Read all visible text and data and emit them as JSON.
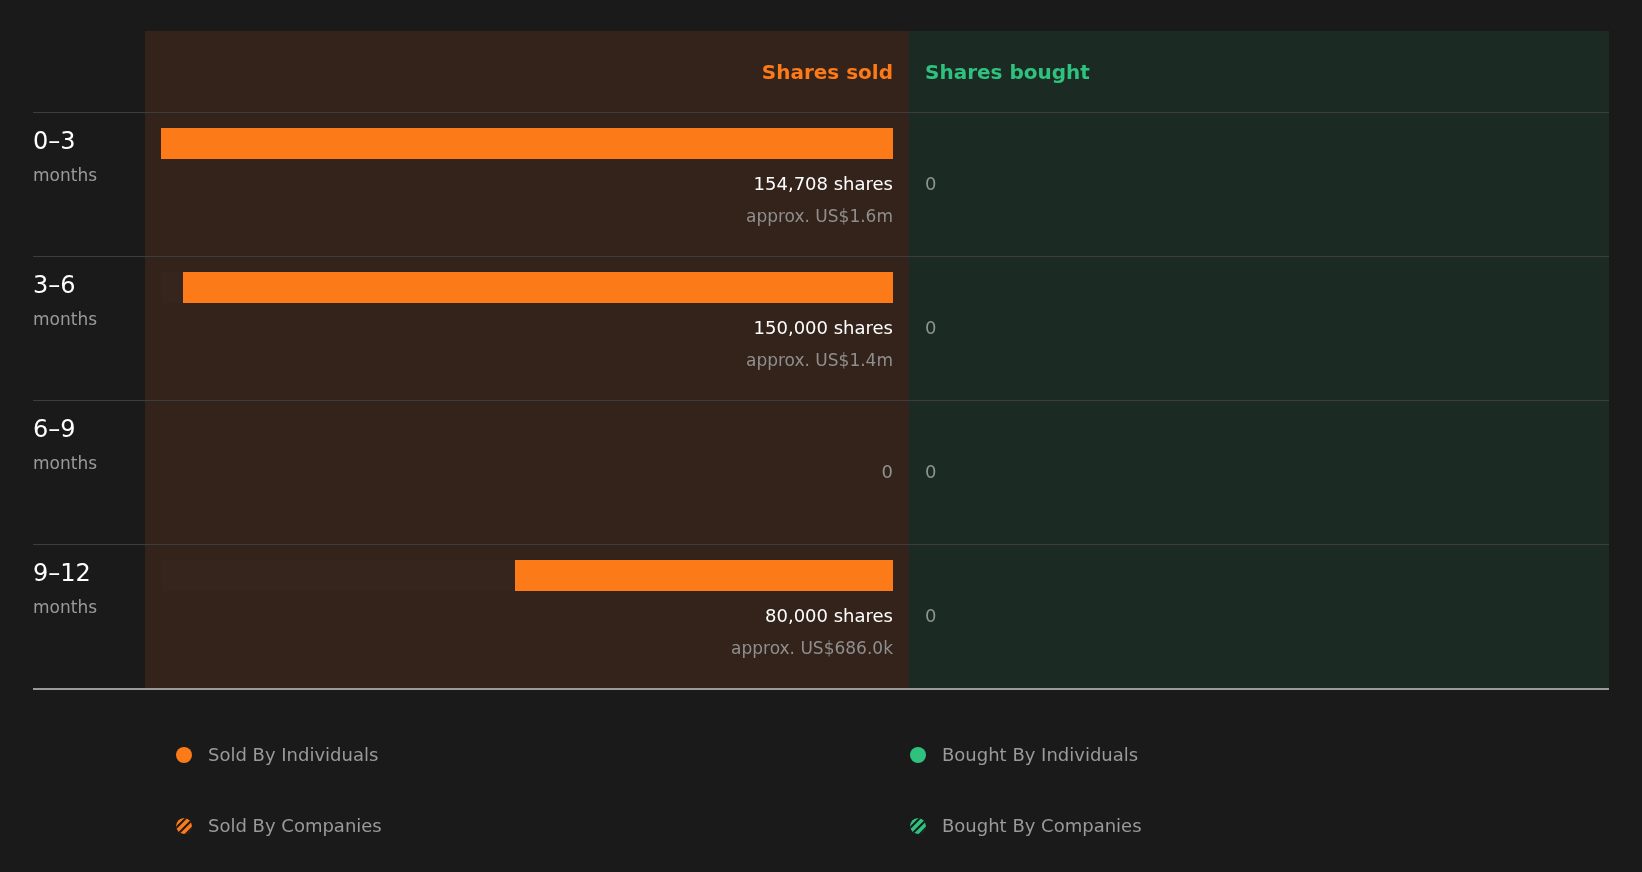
{
  "columns": {
    "sold": "Shares sold",
    "bought": "Shares bought"
  },
  "rows": [
    {
      "period": "0–3",
      "unit": "months",
      "sold": {
        "level": 1,
        "shares": "154,708 shares",
        "value": "approx. US$1.6m"
      },
      "bought": {
        "shares": "0"
      }
    },
    {
      "period": "3–6",
      "unit": "months",
      "sold": {
        "level": 0.97,
        "shares": "150,000 shares",
        "value": "approx. US$1.4m"
      },
      "bought": {
        "shares": "0"
      }
    },
    {
      "period": "6–9",
      "unit": "months",
      "sold": {
        "shares": "0"
      },
      "bought": {
        "shares": "0"
      }
    },
    {
      "period": "9–12",
      "unit": "months",
      "sold": {
        "level": 0.517,
        "shares": "80,000 shares",
        "value": "approx. US$686.0k"
      },
      "bought": {
        "shares": "0"
      }
    }
  ],
  "legend": [
    {
      "label": "Sold By Individuals",
      "kind": "solid",
      "color": "#fd7a18"
    },
    {
      "label": "Bought By Individuals",
      "kind": "solid",
      "color": "#2ec27e"
    },
    {
      "label": "Sold By Companies",
      "kind": "striped",
      "color": "#fd7a18"
    },
    {
      "label": "Bought By Companies",
      "kind": "striped",
      "color": "#2ec27e"
    }
  ]
}
